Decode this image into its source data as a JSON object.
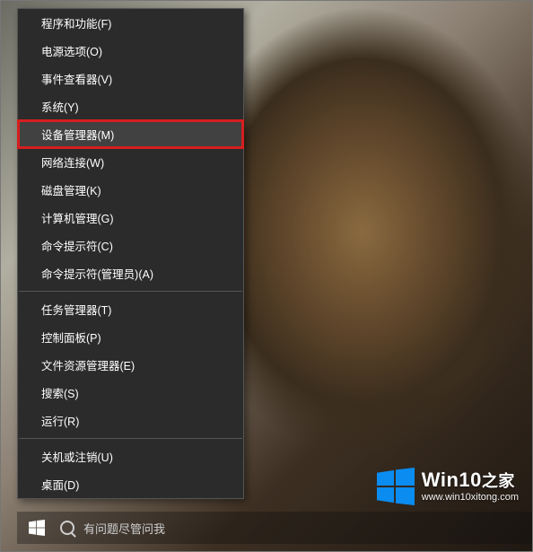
{
  "menu": {
    "groups": [
      [
        {
          "label": "程序和功能(F)",
          "highlighted": false
        },
        {
          "label": "电源选项(O)",
          "highlighted": false
        },
        {
          "label": "事件查看器(V)",
          "highlighted": false
        },
        {
          "label": "系统(Y)",
          "highlighted": false
        },
        {
          "label": "设备管理器(M)",
          "highlighted": true
        },
        {
          "label": "网络连接(W)",
          "highlighted": false
        },
        {
          "label": "磁盘管理(K)",
          "highlighted": false
        },
        {
          "label": "计算机管理(G)",
          "highlighted": false
        },
        {
          "label": "命令提示符(C)",
          "highlighted": false
        },
        {
          "label": "命令提示符(管理员)(A)",
          "highlighted": false
        }
      ],
      [
        {
          "label": "任务管理器(T)",
          "highlighted": false
        },
        {
          "label": "控制面板(P)",
          "highlighted": false
        },
        {
          "label": "文件资源管理器(E)",
          "highlighted": false
        },
        {
          "label": "搜索(S)",
          "highlighted": false
        },
        {
          "label": "运行(R)",
          "highlighted": false
        }
      ],
      [
        {
          "label": "关机或注销(U)",
          "highlighted": false
        },
        {
          "label": "桌面(D)",
          "highlighted": false
        }
      ]
    ]
  },
  "taskbar": {
    "search_placeholder": "有问题尽管问我"
  },
  "watermark": {
    "brand_en": "Win10",
    "brand_zh": "之家",
    "url": "www.win10xitong.com"
  },
  "colors": {
    "menu_bg": "#2b2b2b",
    "menu_border": "#555555",
    "highlight_outline": "#d61e1f",
    "win_logo": "#0078d7"
  }
}
